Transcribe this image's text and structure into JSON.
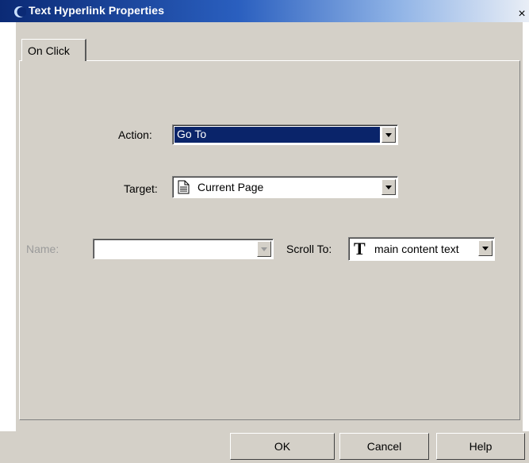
{
  "window": {
    "title": "Text Hyperlink Properties",
    "close_glyph": "×",
    "title_icon": "app-crescent-icon"
  },
  "tabs": [
    {
      "label": "On Click",
      "active": true
    }
  ],
  "form": {
    "action_label": "Action:",
    "action_value": "Go To",
    "target_label": "Target:",
    "target_value": "Current Page",
    "target_icon": "page-icon",
    "name_label": "Name:",
    "name_value": "",
    "scroll_label": "Scroll To:",
    "scroll_value": "main content text",
    "scroll_icon": "text-T-icon"
  },
  "buttons": {
    "ok": "OK",
    "cancel": "Cancel",
    "help": "Help"
  },
  "colors": {
    "selection": "#0a246a",
    "dialog_bg": "#d4d0c8"
  }
}
